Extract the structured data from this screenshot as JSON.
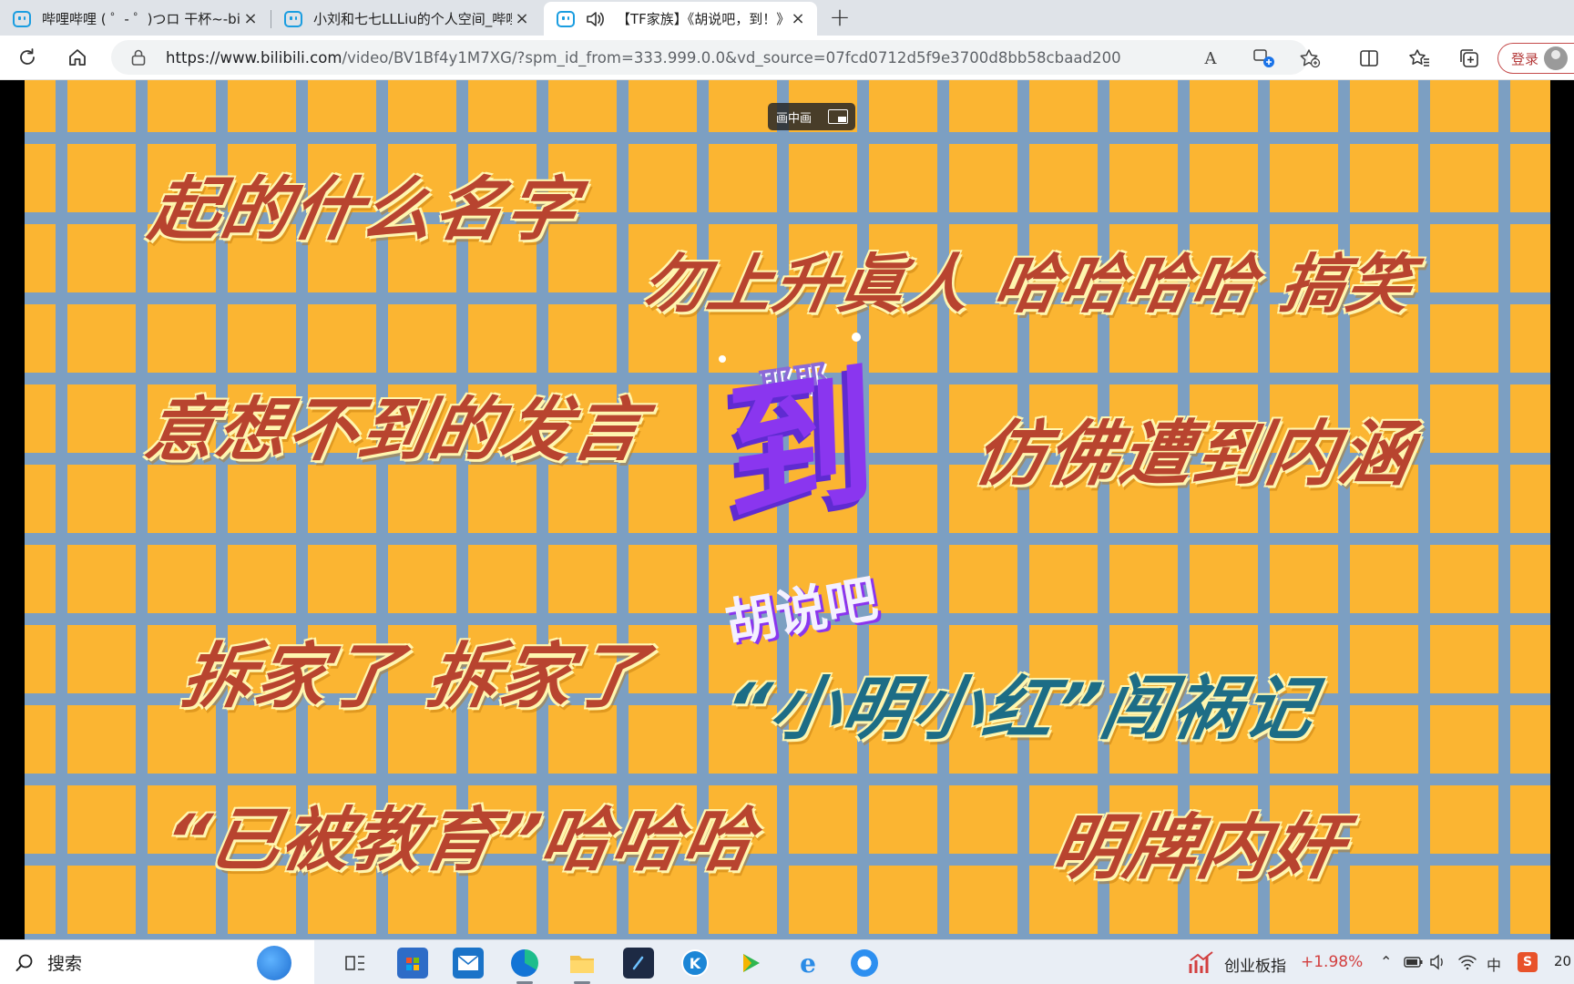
{
  "browser": {
    "tabs": [
      {
        "title": "哔哩哔哩 ( ゜- ゜)つロ 干杯~-bilib",
        "active": false
      },
      {
        "title": "小刘和七七LLLiu的个人空间_哔哩",
        "active": false
      },
      {
        "title": "【TF家族】《胡说吧，到！》",
        "active": true
      }
    ],
    "close_glyph": "×",
    "new_tab_glyph": "+",
    "url_host": "https://www.bilibili.com",
    "url_path": "/video/BV1Bf4y1M7XG/?spm_id_from=333.999.0.0&vd_source=07fcd0712d5f9e3700d8bb58cbaad200",
    "read_aloud_glyph": "A",
    "login_label": "登录"
  },
  "video": {
    "pip_label": "画中画",
    "captions": [
      {
        "text": "起的什么名字",
        "style": "red"
      },
      {
        "text": "勿上升眞人 哈哈哈哈 搞笑",
        "style": "red"
      },
      {
        "text": "意想不到的发言",
        "style": "red"
      },
      {
        "text": "仿佛遭到内涵",
        "style": "red"
      },
      {
        "text": "拆家了 拆家了",
        "style": "red"
      },
      {
        "text": "“小明小红”闯祸记",
        "style": "teal"
      },
      {
        "text": "“已被教育”哈哈哈",
        "style": "red"
      },
      {
        "text": "明牌内奸",
        "style": "red"
      }
    ],
    "logo": {
      "top": "耶耶",
      "big": "到",
      "bottom": "胡说吧"
    },
    "colors": {
      "background": "#fbb532",
      "grid": "#7c9fc2",
      "caption_red": "#b8442f",
      "caption_teal": "#1d6d86",
      "logo_purple": "#8a36ef"
    }
  },
  "taskbar": {
    "search_placeholder": "搜索",
    "pinned": [
      "task-view-icon",
      "store-icon",
      "mail-icon",
      "edge-icon",
      "file-explorer-icon",
      "terminal-icon",
      "k-app-icon",
      "media-player-icon",
      "ie-icon",
      "browser-icon"
    ],
    "stock_name": "创业板指",
    "stock_change": "+1.98%",
    "ime": "中",
    "clock_partial": "20"
  }
}
